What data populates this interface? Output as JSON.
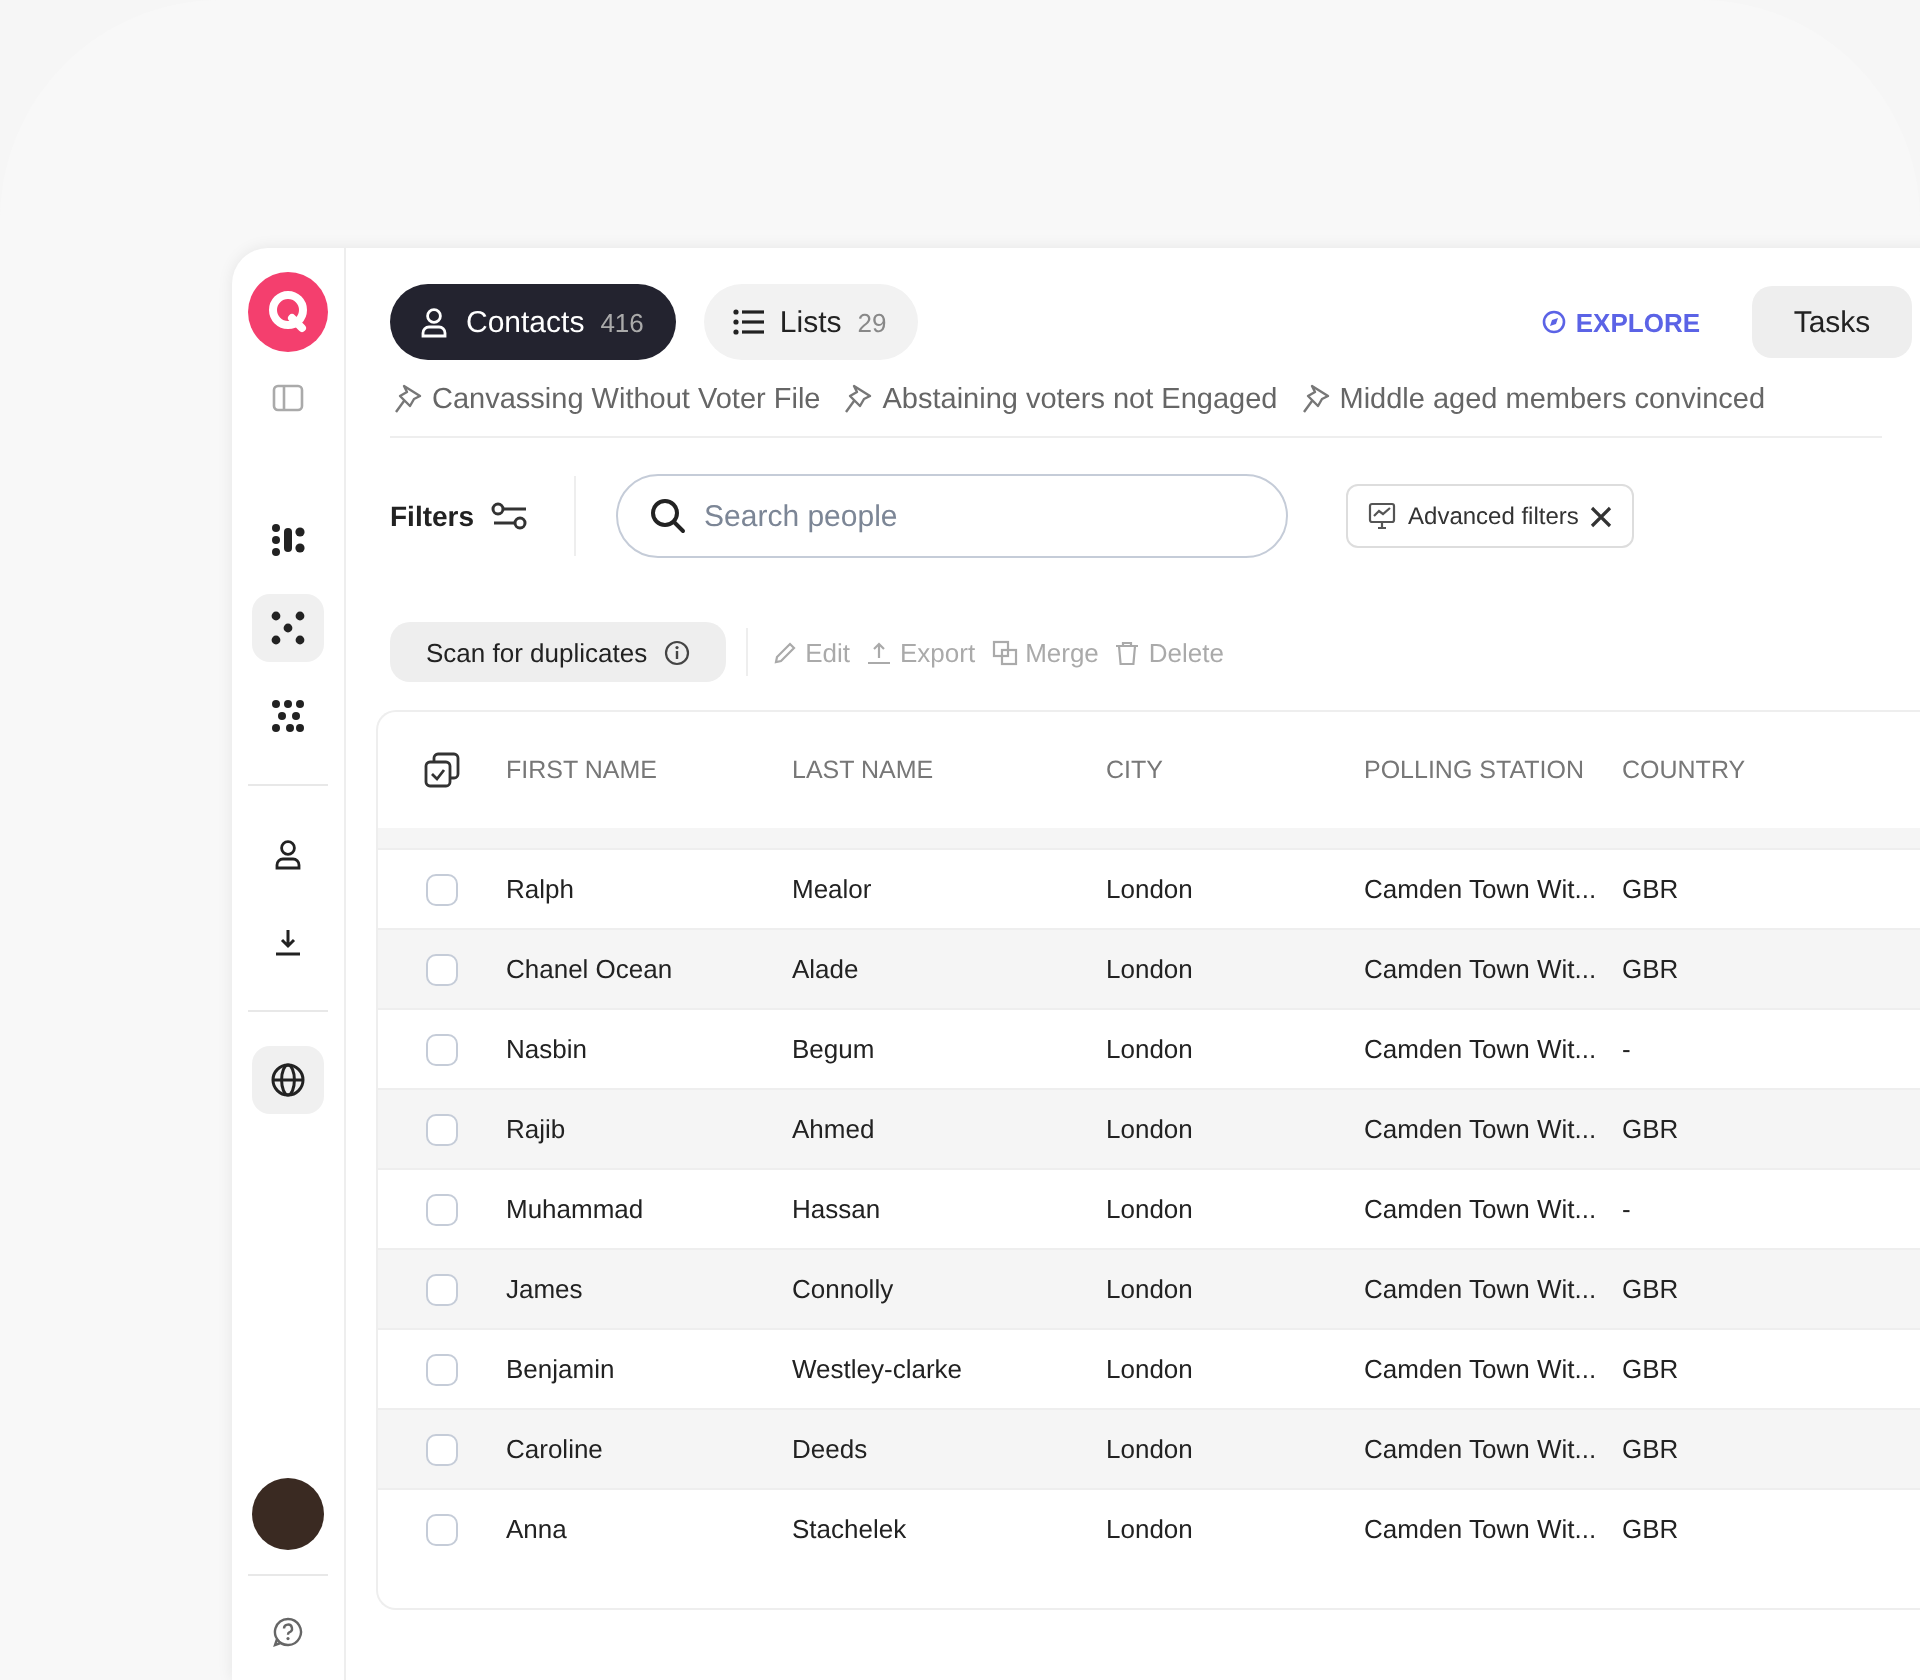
{
  "sidebar": {
    "nav_items": [
      {
        "kind": "grid",
        "selected": false
      },
      {
        "kind": "cross",
        "selected": true
      },
      {
        "kind": "scatter",
        "selected": false
      },
      {
        "kind": "person",
        "selected": false
      },
      {
        "kind": "download",
        "selected": false
      },
      {
        "kind": "globe",
        "selected": true
      }
    ]
  },
  "tabs": [
    {
      "label": "Contacts",
      "count": "416",
      "kind": "person",
      "selected": true
    },
    {
      "label": "Lists",
      "count": "29",
      "kind": "list",
      "selected": false
    }
  ],
  "explore_link": "EXPLORE",
  "tasks_button": "Tasks",
  "pinned_lists": [
    "Canvassing Without Voter File",
    "Abstaining voters not Engaged",
    "Middle aged members convinced"
  ],
  "filters_label": "Filters",
  "search": {
    "placeholder": "Search people"
  },
  "advanced_filters": "Advanced filters",
  "scan_button": "Scan for duplicates",
  "actions": [
    "Edit",
    "Export",
    "Merge",
    "Delete"
  ],
  "table": {
    "columns": [
      "FIRST NAME",
      "LAST NAME",
      "CITY",
      "POLLING STATION",
      "COUNTRY"
    ],
    "rows": [
      {
        "cells": [
          "Ralph",
          "Mealor",
          "London",
          "Camden Town Wit...",
          "GBR"
        ],
        "selected": false
      },
      {
        "cells": [
          "Chanel Ocean",
          "Alade",
          "London",
          "Camden Town Wit...",
          "GBR"
        ],
        "selected": false
      },
      {
        "cells": [
          "Nasbin",
          "Begum",
          "London",
          "Camden Town Wit...",
          "-"
        ],
        "selected": false
      },
      {
        "cells": [
          "Rajib",
          "Ahmed",
          "London",
          "Camden Town Wit...",
          "GBR"
        ],
        "selected": false
      },
      {
        "cells": [
          "Muhammad",
          "Hassan",
          "London",
          "Camden Town Wit...",
          "-"
        ],
        "selected": false
      },
      {
        "cells": [
          "James",
          "Connolly",
          "London",
          "Camden Town Wit...",
          "GBR"
        ],
        "selected": false
      },
      {
        "cells": [
          "Benjamin",
          "Westley-clarke",
          "London",
          "Camden Town Wit...",
          "GBR"
        ],
        "selected": false
      },
      {
        "cells": [
          "Caroline",
          "Deeds",
          "London",
          "Camden Town Wit...",
          "GBR"
        ],
        "selected": false
      },
      {
        "cells": [
          "Anna",
          "Stachelek",
          "London",
          "Camden Town Wit...",
          "GBR"
        ],
        "selected": false
      }
    ]
  }
}
